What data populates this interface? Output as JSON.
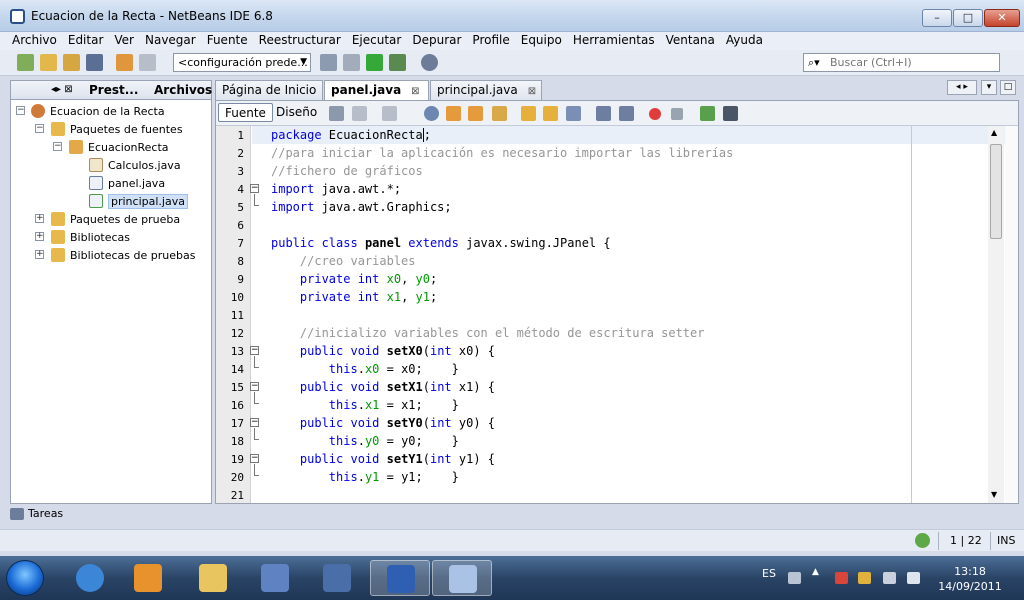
{
  "window": {
    "title": "Ecuacion de la Recta - NetBeans IDE 6.8",
    "min_label": "–",
    "max_label": "□",
    "close_label": "✕"
  },
  "menu": [
    "Archivo",
    "Editar",
    "Ver",
    "Navegar",
    "Fuente",
    "Reestructurar",
    "Ejecutar",
    "Depurar",
    "Profile",
    "Equipo",
    "Herramientas",
    "Ventana",
    "Ayuda"
  ],
  "toolbar": {
    "config_value": "<configuración prede...",
    "search_placeholder": "Buscar (Ctrl+I)"
  },
  "left_panel": {
    "tabs": [
      "Prest...",
      "Archivos"
    ],
    "tree": {
      "project": "Ecuacion de la Recta",
      "source_packages": "Paquetes de fuentes",
      "package": "EcuacionRecta",
      "files": [
        "Calculos.java",
        "panel.java",
        "principal.java"
      ],
      "test_packages": "Paquetes de prueba",
      "libraries": "Bibliotecas",
      "test_libraries": "Bibliotecas de pruebas"
    }
  },
  "editor": {
    "tabs": [
      {
        "label": "Página de Inicio",
        "close": "⊠"
      },
      {
        "label": "panel.java",
        "close": "⊠"
      },
      {
        "label": "principal.java",
        "close": "⊠"
      }
    ],
    "mode_source": "Fuente",
    "mode_design": "Diseño",
    "line_numbers": [
      "1",
      "2",
      "3",
      "4",
      "5",
      "6",
      "7",
      "8",
      "9",
      "10",
      "11",
      "12",
      "13",
      "14",
      "15",
      "16",
      "17",
      "18",
      "19",
      "20",
      "21"
    ]
  },
  "code": [
    [
      {
        "t": "package",
        "c": "kw"
      },
      {
        "t": " EcuacionRecta;"
      }
    ],
    [
      {
        "t": "//para iniciar la aplicación es necesario importar las librerías",
        "c": "cm"
      }
    ],
    [
      {
        "t": "//fichero de gráficos",
        "c": "cm"
      }
    ],
    [
      {
        "t": "import",
        "c": "kw"
      },
      {
        "t": " java.awt.*;"
      }
    ],
    [
      {
        "t": "import",
        "c": "kw"
      },
      {
        "t": " java.awt.Graphics;"
      }
    ],
    [],
    [
      {
        "t": "public class",
        "c": "kw"
      },
      {
        "t": " "
      },
      {
        "t": "panel",
        "c": "b"
      },
      {
        "t": " "
      },
      {
        "t": "extends",
        "c": "kw"
      },
      {
        "t": " javax.swing.JPanel {"
      }
    ],
    [
      {
        "t": "    "
      },
      {
        "t": "//creo variables",
        "c": "cm"
      }
    ],
    [
      {
        "t": "    "
      },
      {
        "t": "private int",
        "c": "kw"
      },
      {
        "t": " "
      },
      {
        "t": "x0",
        "c": "fd"
      },
      {
        "t": ", "
      },
      {
        "t": "y0",
        "c": "fd"
      },
      {
        "t": ";"
      }
    ],
    [
      {
        "t": "    "
      },
      {
        "t": "private int",
        "c": "kw"
      },
      {
        "t": " "
      },
      {
        "t": "x1",
        "c": "fd"
      },
      {
        "t": ", "
      },
      {
        "t": "y1",
        "c": "fd"
      },
      {
        "t": ";"
      }
    ],
    [],
    [
      {
        "t": "    "
      },
      {
        "t": "//inicializo variables con el método de escritura setter",
        "c": "cm"
      }
    ],
    [
      {
        "t": "    "
      },
      {
        "t": "public void",
        "c": "kw"
      },
      {
        "t": " "
      },
      {
        "t": "setX0",
        "c": "b"
      },
      {
        "t": "("
      },
      {
        "t": "int",
        "c": "kw"
      },
      {
        "t": " x0) {"
      }
    ],
    [
      {
        "t": "        "
      },
      {
        "t": "this",
        "c": "kw"
      },
      {
        "t": "."
      },
      {
        "t": "x0",
        "c": "fd"
      },
      {
        "t": " = x0;    }"
      }
    ],
    [
      {
        "t": "    "
      },
      {
        "t": "public void",
        "c": "kw"
      },
      {
        "t": " "
      },
      {
        "t": "setX1",
        "c": "b"
      },
      {
        "t": "("
      },
      {
        "t": "int",
        "c": "kw"
      },
      {
        "t": " x1) {"
      }
    ],
    [
      {
        "t": "        "
      },
      {
        "t": "this",
        "c": "kw"
      },
      {
        "t": "."
      },
      {
        "t": "x1",
        "c": "fd"
      },
      {
        "t": " = x1;    }"
      }
    ],
    [
      {
        "t": "    "
      },
      {
        "t": "public void",
        "c": "kw"
      },
      {
        "t": " "
      },
      {
        "t": "setY0",
        "c": "b"
      },
      {
        "t": "("
      },
      {
        "t": "int",
        "c": "kw"
      },
      {
        "t": " y0) {"
      }
    ],
    [
      {
        "t": "        "
      },
      {
        "t": "this",
        "c": "kw"
      },
      {
        "t": "."
      },
      {
        "t": "y0",
        "c": "fd"
      },
      {
        "t": " = y0;    }"
      }
    ],
    [
      {
        "t": "    "
      },
      {
        "t": "public void",
        "c": "kw"
      },
      {
        "t": " "
      },
      {
        "t": "setY1",
        "c": "b"
      },
      {
        "t": "("
      },
      {
        "t": "int",
        "c": "kw"
      },
      {
        "t": " y1) {"
      }
    ],
    [
      {
        "t": "        "
      },
      {
        "t": "this",
        "c": "kw"
      },
      {
        "t": "."
      },
      {
        "t": "y1",
        "c": "fd"
      },
      {
        "t": " = y1;    }"
      }
    ],
    []
  ],
  "tasks_label": "Tareas",
  "status": {
    "position": "1 | 22",
    "mode": "INS"
  },
  "taskbar": {
    "language": "ES",
    "time": "13:18",
    "date": "14/09/2011"
  }
}
